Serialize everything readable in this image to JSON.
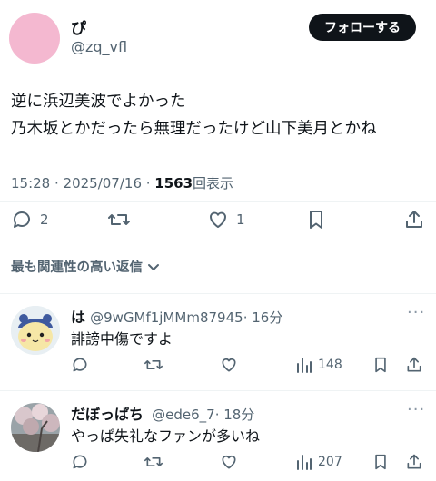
{
  "post": {
    "name": "ぴ",
    "handle": "@zq_vfl",
    "follow_label": "フォローする",
    "lines": [
      "逆に浜辺美波でよかった",
      "乃木坂とかだったら無理だったけど山下美月とかね"
    ],
    "time": "15:28 · 2025/07/16 · ",
    "views": "1563",
    "views_label": "回表示",
    "reply_count": "2",
    "like_count": "1",
    "avatar_color": "#f4b8d0"
  },
  "sort_label": "最も関連性の高い返信",
  "replies": [
    {
      "name": "は",
      "handle": "@9wGMf1jMMm87945",
      "time": "· 16分",
      "text": "誹謗中傷ですよ",
      "views": "148",
      "avatar_icon": "character-avatar"
    },
    {
      "name": "だぼっぱち",
      "handle": "@ede6_7",
      "time": "· 18分",
      "text": "やっぱ失礼なファンが多いね",
      "views": "207",
      "avatar_icon": "cherry-blossom-photo-avatar"
    }
  ]
}
